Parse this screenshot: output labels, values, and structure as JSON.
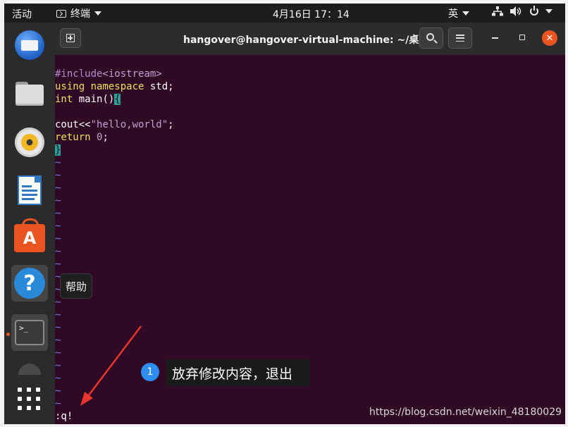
{
  "topbar": {
    "activities": "活动",
    "app_menu": "终端",
    "clock": "4月16日  17：14",
    "input_method": "英"
  },
  "dock": {
    "items": [
      {
        "name": "thunderbird"
      },
      {
        "name": "files"
      },
      {
        "name": "rhythmbox"
      },
      {
        "name": "libreoffice-writer"
      },
      {
        "name": "ubuntu-software"
      },
      {
        "name": "help"
      },
      {
        "name": "terminal",
        "glyph": ">_"
      }
    ],
    "tooltip": "帮助"
  },
  "window": {
    "title": "hangover@hangover-virtual-machine: ~/桌面",
    "close_glyph": "✕"
  },
  "terminal": {
    "lines": [
      "#include<iostream>",
      "using namespace std;",
      "int main(){",
      "",
      "cout<<\"hello,world\";",
      "return 0;",
      "}"
    ],
    "tilde": "~",
    "command": ":q!"
  },
  "annotation": {
    "step": "1",
    "label": "放弃修改内容，退出"
  },
  "watermark": "https://blog.csdn.net/weixin_48180029",
  "colors": {
    "terminal_bg": "#300a24",
    "accent": "#e95420",
    "keyword": "#f0e05a",
    "string": "#c89ad2",
    "tilde": "#6a83e8",
    "arrow": "#e8362c"
  }
}
